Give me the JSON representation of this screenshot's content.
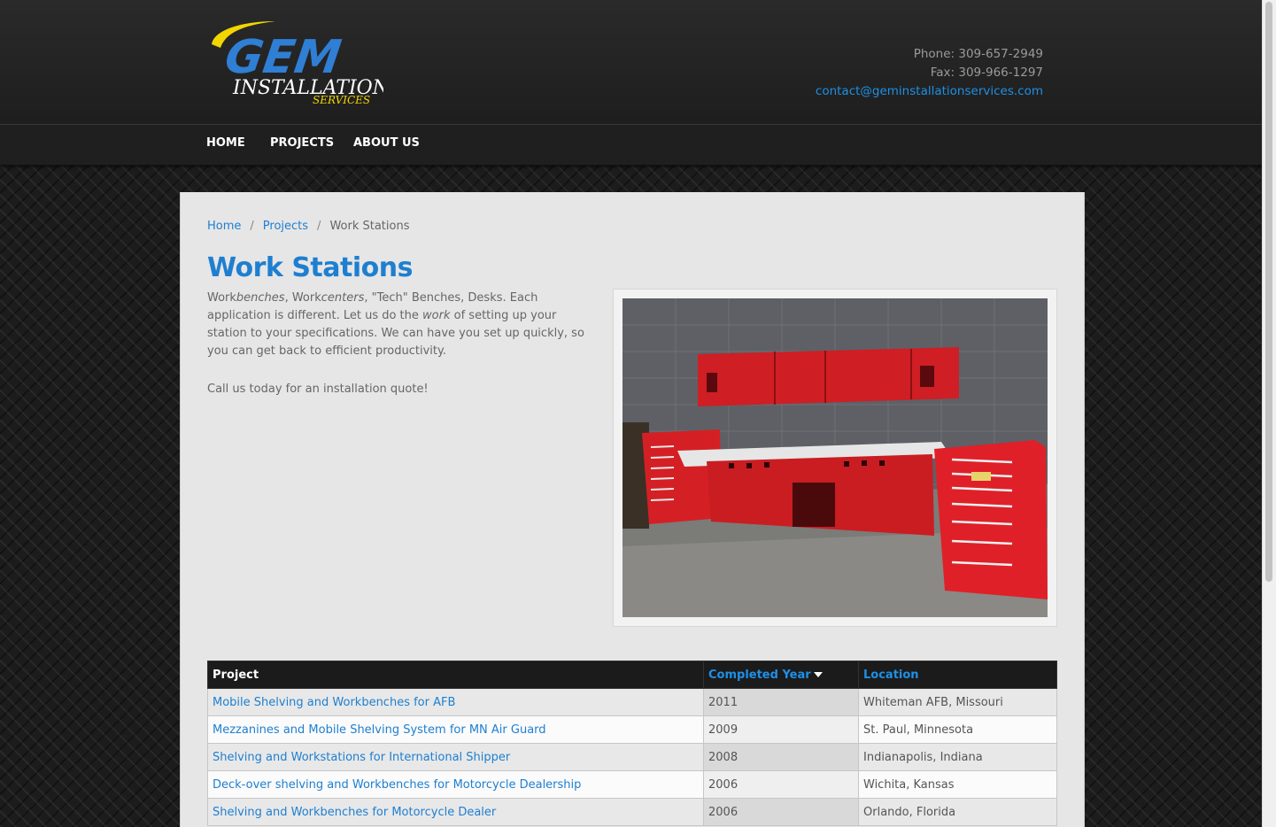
{
  "header": {
    "logo": {
      "primary": "GEM",
      "line2": "INSTALLATION",
      "line3": "SERVICES"
    },
    "contact": {
      "phone": "Phone: 309-657-2949",
      "fax": "Fax: 309-966-1297",
      "email": "contact@geminstallationservices.com"
    }
  },
  "nav": {
    "items": [
      "HOME",
      "PROJECTS",
      "ABOUT US"
    ]
  },
  "breadcrumb": {
    "home": "Home",
    "projects": "Projects",
    "current": "Work Stations",
    "separator": "/"
  },
  "page": {
    "title": "Work Stations",
    "desc": {
      "p1": "Work",
      "p1_em": "benches",
      "p2": ", Work",
      "p2_em": "centers",
      "p3": ", \"Tech\" Benches, Desks.  Each application is different.  Let us do the ",
      "p3_em": "work",
      "p4": " of setting up your station to your specifications.  We can have you set up quickly, so you can get back to efficient productivity."
    },
    "cta": "Call us today for an installation quote!"
  },
  "table": {
    "headers": {
      "project": "Project",
      "year": "Completed Year",
      "location": "Location"
    },
    "rows": [
      {
        "project": "Mobile Shelving and Workbenches for AFB",
        "year": "2011",
        "location": "Whiteman AFB, Missouri"
      },
      {
        "project": "Mezzanines and Mobile Shelving System for MN Air Guard",
        "year": "2009",
        "location": "St. Paul, Minnesota"
      },
      {
        "project": "Shelving and Workstations for International Shipper",
        "year": "2008",
        "location": "Indianapolis, Indiana"
      },
      {
        "project": "Deck-over shelving and Workbenches for Motorcycle Dealership",
        "year": "2006",
        "location": "Wichita, Kansas"
      },
      {
        "project": "Shelving and Workbenches for Motorcycle Dealer",
        "year": "2006",
        "location": "Orlando, Florida"
      }
    ]
  },
  "colors": {
    "accent": "#1e7fd0",
    "logo_yellow": "#f2d600",
    "header_bg": "#222222",
    "bench_red": "#d42025"
  }
}
